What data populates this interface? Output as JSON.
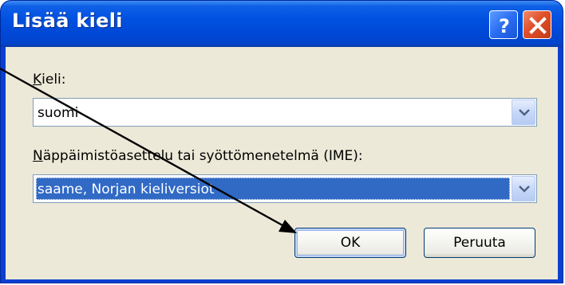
{
  "dialog": {
    "title": "Lisää kieli",
    "help_tooltip": "?",
    "language_label_mnemonic": "K",
    "language_label_rest": "ieli:",
    "language_value": "suomi",
    "ime_label_mnemonic": "N",
    "ime_label_rest": "äppäimistöasettelu tai syöttömenetelmä (IME):",
    "ime_value": "saame, Norjan kieliversiot",
    "ok_label": "OK",
    "cancel_label": "Peruuta"
  },
  "colors": {
    "titlebar": "#0051e0",
    "client": "#ece9d8",
    "selection": "#316ac5",
    "close_button": "#e0502a"
  },
  "icons": [
    "help-icon",
    "close-icon",
    "chevron-down-icon",
    "annotation-arrow"
  ]
}
